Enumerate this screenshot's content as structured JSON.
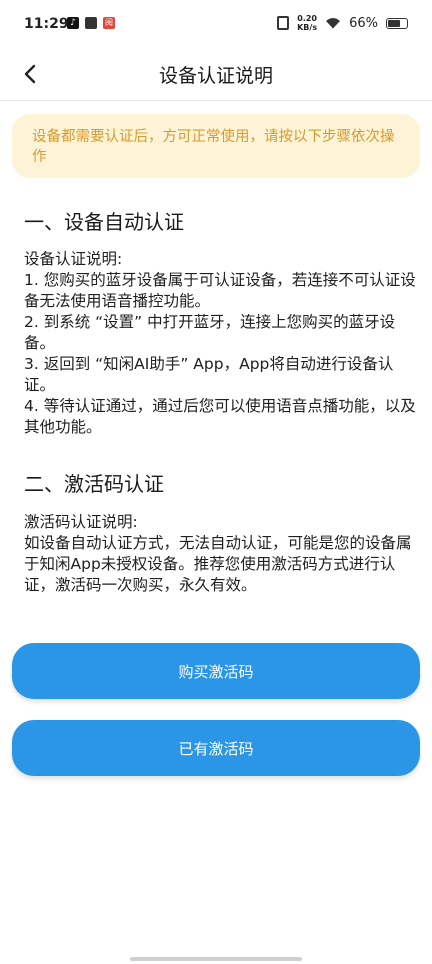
{
  "status_bar": {
    "time": "11:29",
    "app_icons": [
      "tiktok-icon",
      "square-icon",
      "red-app-icon"
    ],
    "net_speed_value": "0.20",
    "net_speed_unit": "KB/s",
    "battery": "66%"
  },
  "header": {
    "back_icon": "chevron-left-icon",
    "title": "设备认证说明"
  },
  "notice": {
    "text": "设备都需要认证后，方可正常使用，请按以下步骤依次操作",
    "color": "#d99a2e",
    "background": "#fdf4d8"
  },
  "section1": {
    "title": "一、设备自动认证",
    "lines": [
      "设备认证说明:",
      "1. 您购买的蓝牙设备属于可认证设备，若连接不可认证设备无法使用语音播控功能。",
      "2. 到系统 “设置” 中打开蓝牙，连接上您购买的蓝牙设备。",
      "3. 返回到 “知闲AI助手” App，App将自动进行设备认证。",
      "4. 等待认证通过，通过后您可以使用语音点播功能，以及其他功能。"
    ]
  },
  "section2": {
    "title": "二、激活码认证",
    "lines": [
      "激活码认证说明:",
      "如设备自动认证方式，无法自动认证，可能是您的设备属于知闲App未授权设备。推荐您使用激活码方式进行认证，激活码一次购买，永久有效。"
    ]
  },
  "buttons": {
    "buy_label": "购买激活码",
    "have_label": "已有激活码",
    "color": "#2b95e6"
  }
}
